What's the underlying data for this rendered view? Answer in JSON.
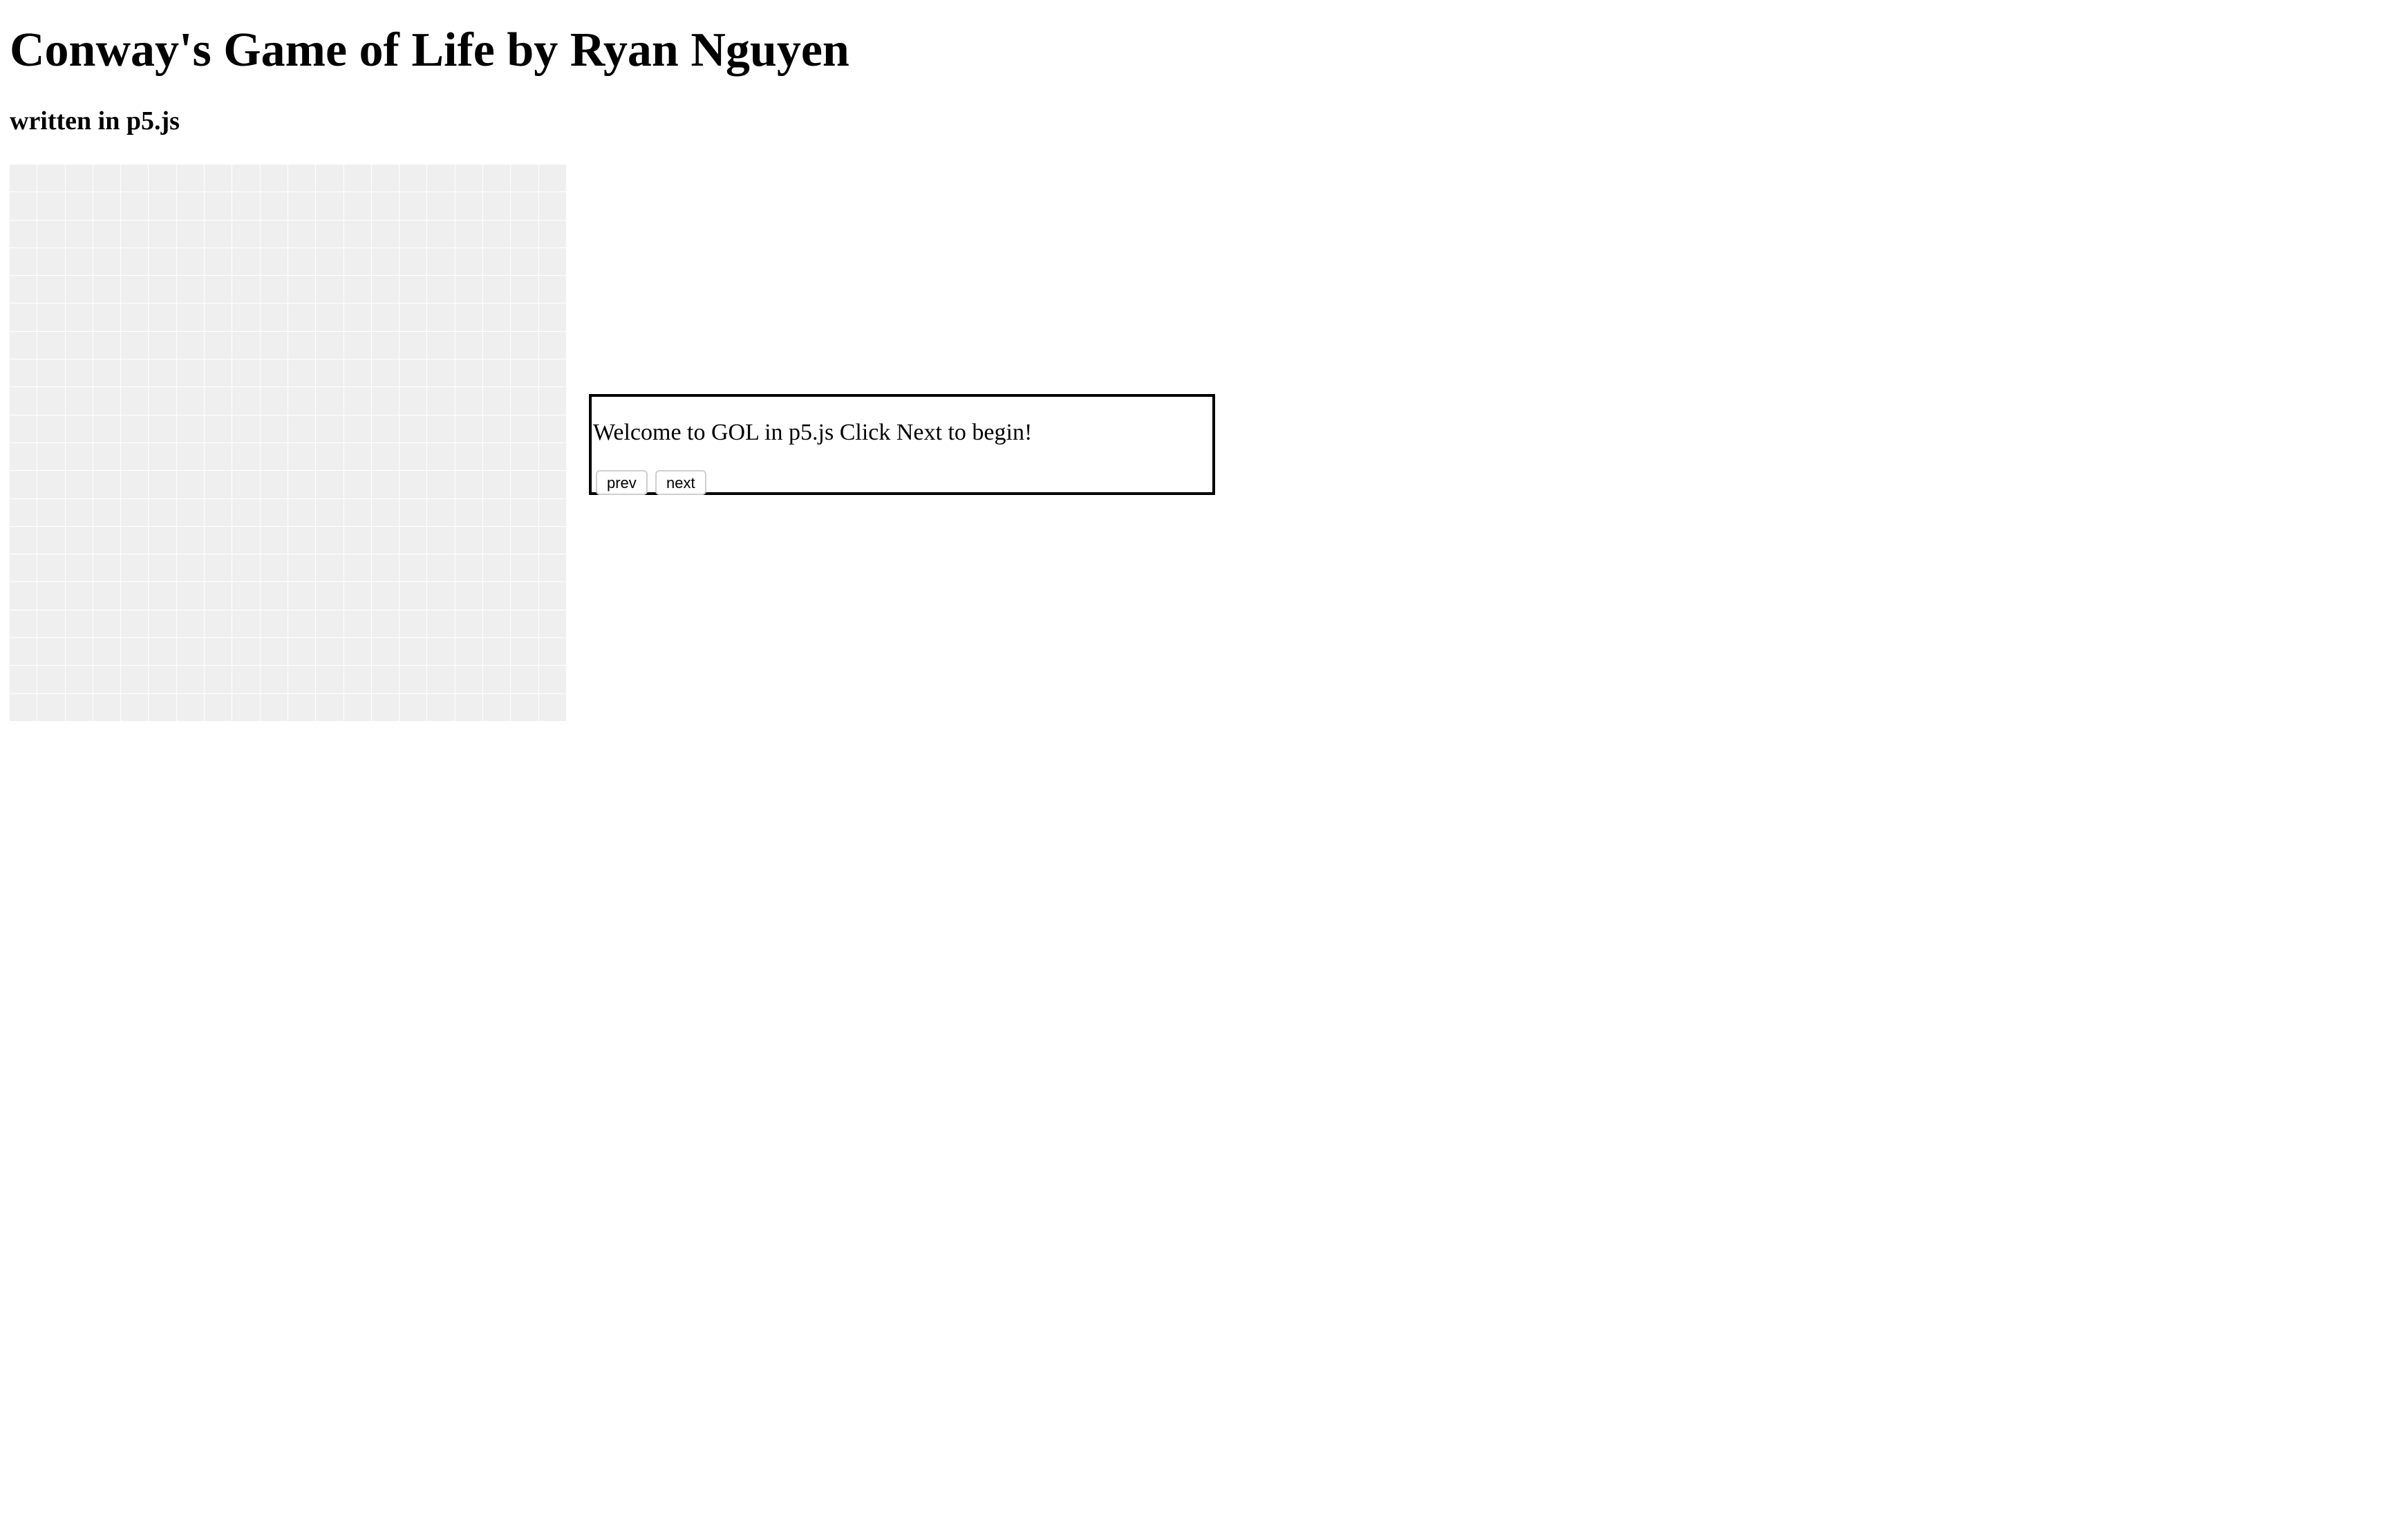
{
  "header": {
    "title": "Conway's Game of Life by Ryan Nguyen",
    "subtitle": "written in p5.js"
  },
  "grid": {
    "rows": 20,
    "cols": 20,
    "cell_color": "#efefef",
    "line_color": "#ffffff"
  },
  "dialog": {
    "message": "Welcome to GOL in p5.js Click Next to begin!",
    "prev_label": "prev",
    "next_label": "next"
  }
}
